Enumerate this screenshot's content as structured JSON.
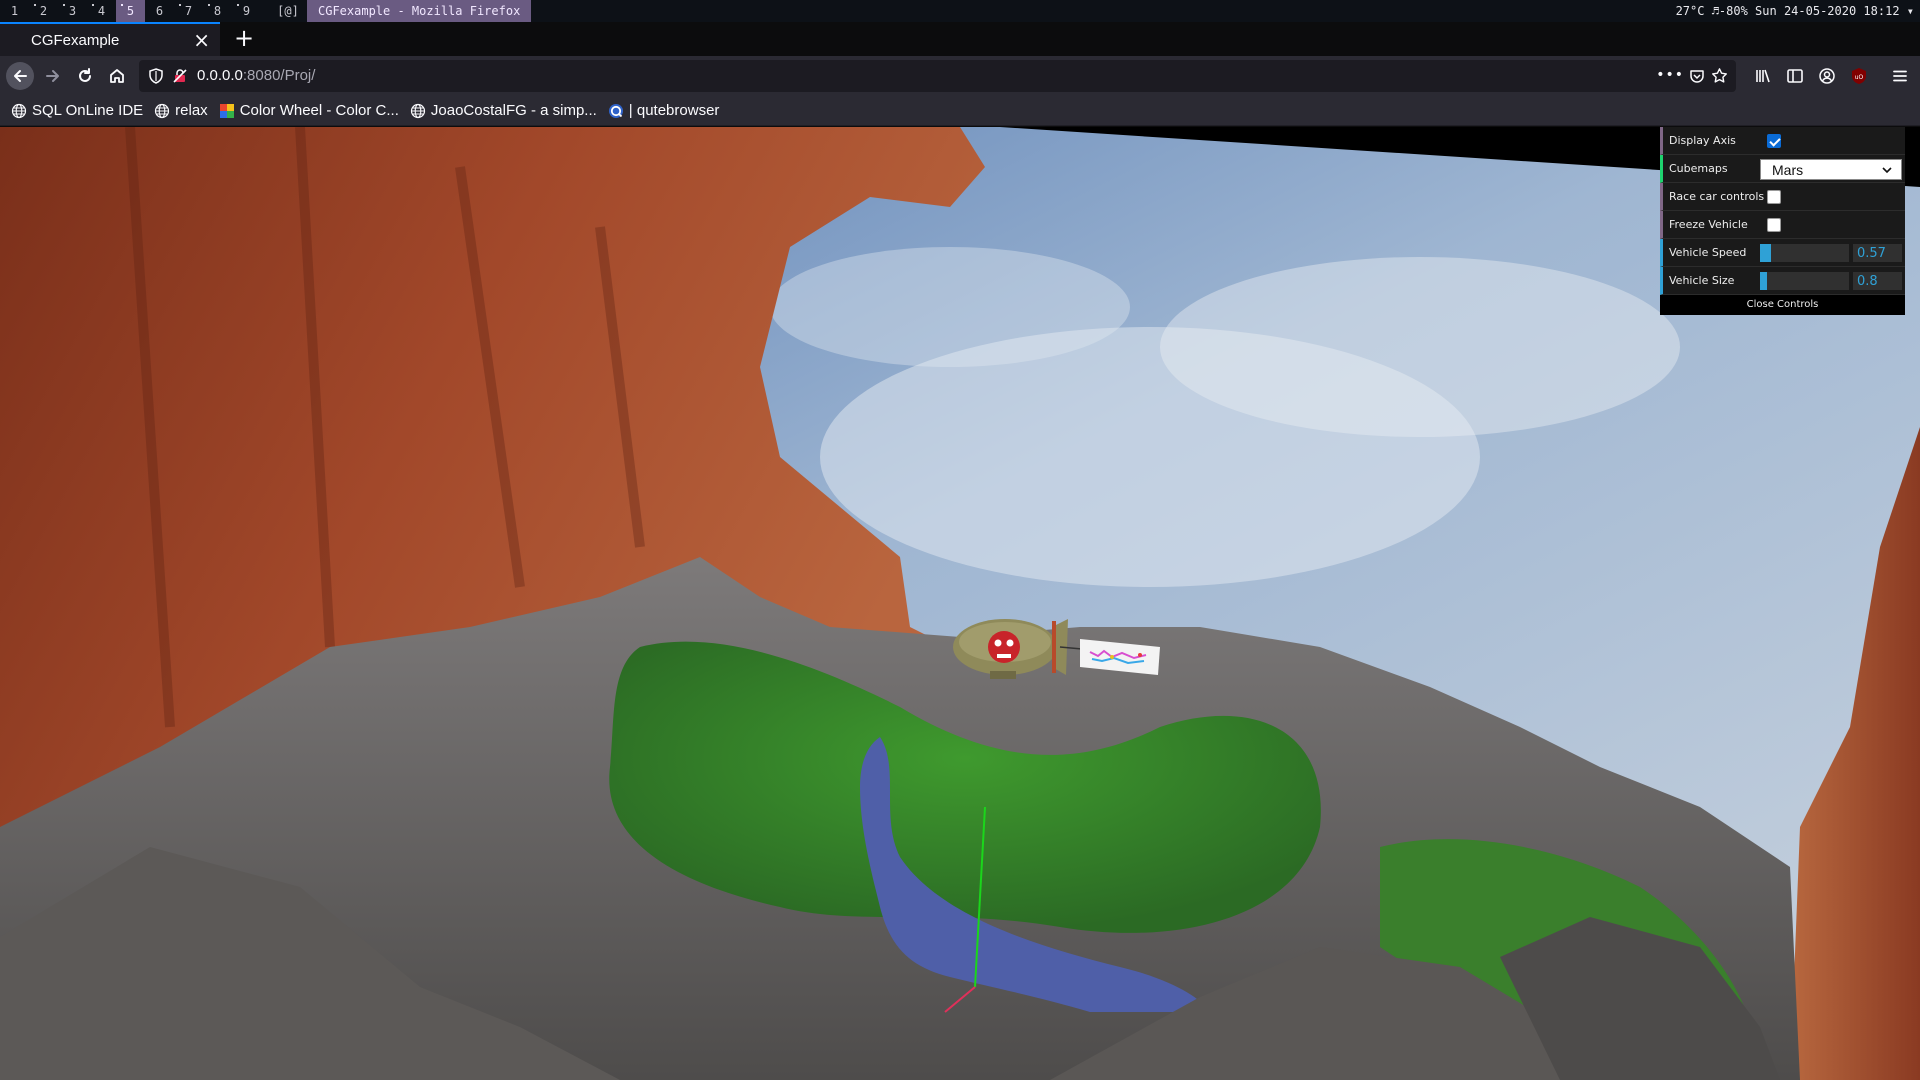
{
  "wm": {
    "workspaces": [
      "1",
      "2",
      "3",
      "4",
      "5",
      "6",
      "7",
      "8",
      "9"
    ],
    "active_workspace": "5",
    "layout": "[@]",
    "window_title": "CGFexample - Mozilla Firefox",
    "status": "27°C ♬-80% Sun 24-05-2020 18:12 ▾"
  },
  "tabs": {
    "active_title": "CGFexample",
    "close_symbol": "×",
    "new_tab_symbol": "+"
  },
  "nav": {
    "url_host": "0.0.0.0",
    "url_path": ":8080/Proj/",
    "page_actions_symbol": "•••"
  },
  "bookmarks": [
    {
      "label": "SQL OnLine IDE",
      "icon": "globe-icon"
    },
    {
      "label": "relax",
      "icon": "globe-icon"
    },
    {
      "label": "Color Wheel - Color C...",
      "icon": "color-wheel-icon"
    },
    {
      "label": "JoaoCostalFG - a simp...",
      "icon": "globe-icon"
    },
    {
      "label": "| qutebrowser",
      "icon": "qutebrowser-icon"
    }
  ],
  "gui": {
    "display_axis": {
      "label": "Display Axis",
      "checked": true
    },
    "cubemaps": {
      "label": "Cubemaps",
      "value": "Mars"
    },
    "race_car_controls": {
      "label": "Race car controls",
      "checked": false
    },
    "freeze_vehicle": {
      "label": "Freeze Vehicle",
      "checked": false
    },
    "vehicle_speed": {
      "label": "Vehicle Speed",
      "value": "0.57",
      "fill_fraction": 0.12
    },
    "vehicle_size": {
      "label": "Vehicle Size",
      "value": "0.8",
      "fill_fraction": 0.08
    },
    "close_label": "Close Controls"
  },
  "colors": {
    "accent_blue": "#0a84ff",
    "gui_number": "#2fa1d6",
    "wm_highlight": "#6a5b82"
  }
}
